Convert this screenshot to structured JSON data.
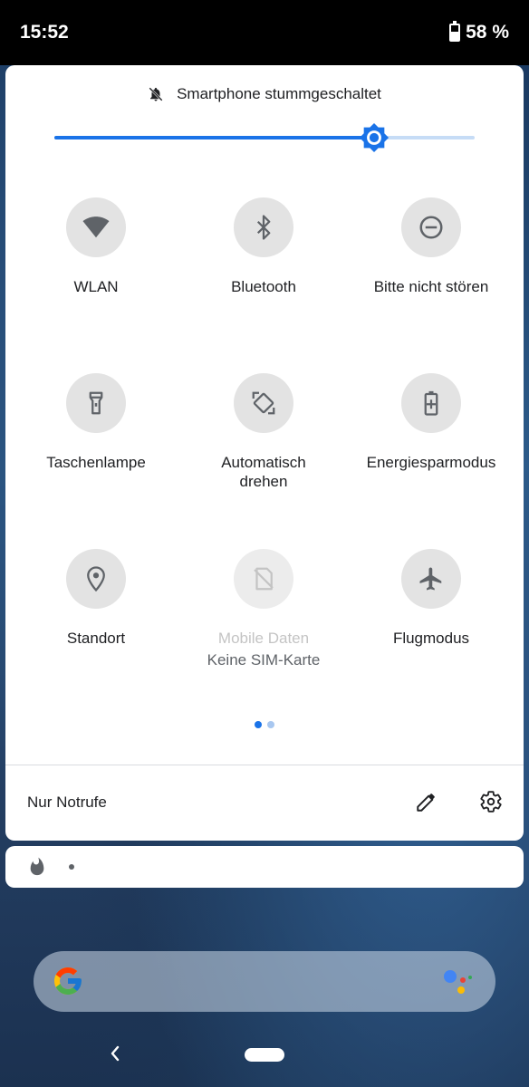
{
  "status_bar": {
    "time": "15:52",
    "battery": "58 %",
    "battery_level": 0.58
  },
  "quick_settings": {
    "silent_text": "Smartphone stummgeschaltet",
    "brightness": 0.76,
    "tiles": [
      {
        "id": "wlan",
        "label": "WLAN",
        "icon": "wifi-icon"
      },
      {
        "id": "bluetooth",
        "label": "Bluetooth",
        "icon": "bluetooth-icon"
      },
      {
        "id": "dnd",
        "label": "Bitte nicht stören",
        "icon": "do-not-disturb-icon"
      },
      {
        "id": "flashlight",
        "label": "Taschenlampe",
        "icon": "flashlight-icon"
      },
      {
        "id": "autorotate",
        "label": "Automatisch\ndrehen",
        "icon": "auto-rotate-icon"
      },
      {
        "id": "battery_saver",
        "label": "Energiesparmodus",
        "icon": "battery-saver-icon"
      },
      {
        "id": "location",
        "label": "Standort",
        "icon": "location-icon"
      },
      {
        "id": "mobile_data",
        "label": "Mobile Daten",
        "sublabel": "Keine SIM-Karte",
        "icon": "no-sim-icon",
        "disabled": true
      },
      {
        "id": "airplane",
        "label": "Flugmodus",
        "icon": "airplane-icon"
      }
    ],
    "page_indicator": {
      "pages": 2,
      "active": 0
    },
    "footer_text": "Nur Notrufe",
    "edit_icon": "pencil-icon",
    "settings_icon": "gear-icon"
  },
  "notification": {
    "icon": "flame-icon"
  },
  "home": {
    "search_icon": "google-g-icon",
    "assistant_icon": "assistant-icon"
  },
  "colors": {
    "accent": "#1a73e8",
    "accent_light": "#c6dcf6",
    "tile_bg": "#e3e3e3",
    "icon": "#5f6368"
  }
}
